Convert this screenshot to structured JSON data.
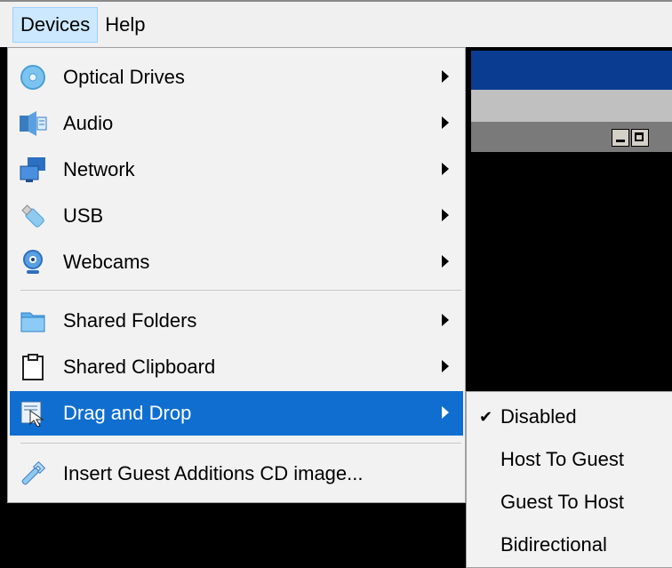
{
  "menubar": {
    "items": [
      {
        "label": "Devices"
      },
      {
        "label": "Help"
      }
    ]
  },
  "devices_menu": {
    "items": [
      {
        "label": "Optical Drives",
        "icon": "optical-disc-icon",
        "has_submenu": true
      },
      {
        "label": "Audio",
        "icon": "audio-speaker-icon",
        "has_submenu": true
      },
      {
        "label": "Network",
        "icon": "network-icon",
        "has_submenu": true
      },
      {
        "label": "USB",
        "icon": "usb-icon",
        "has_submenu": true
      },
      {
        "label": "Webcams",
        "icon": "webcam-icon",
        "has_submenu": true
      },
      {
        "label": "Shared Folders",
        "icon": "folder-icon",
        "has_submenu": true
      },
      {
        "label": "Shared Clipboard",
        "icon": "clipboard-icon",
        "has_submenu": true
      },
      {
        "label": "Drag and Drop",
        "icon": "drag-drop-icon",
        "has_submenu": true,
        "highlighted": true
      },
      {
        "label": "Insert Guest Additions CD image...",
        "icon": "wrench-icon",
        "has_submenu": false
      }
    ]
  },
  "drag_drop_submenu": {
    "items": [
      {
        "label": "Disabled",
        "checked": true
      },
      {
        "label": "Host To Guest",
        "checked": false
      },
      {
        "label": "Guest To Host",
        "checked": false
      },
      {
        "label": "Bidirectional",
        "checked": false
      }
    ],
    "check_glyph": "✔"
  },
  "colors": {
    "highlight": "#0f6ed0",
    "menu_bg": "#f2f2f2",
    "title_bar": "#0a3d91"
  }
}
